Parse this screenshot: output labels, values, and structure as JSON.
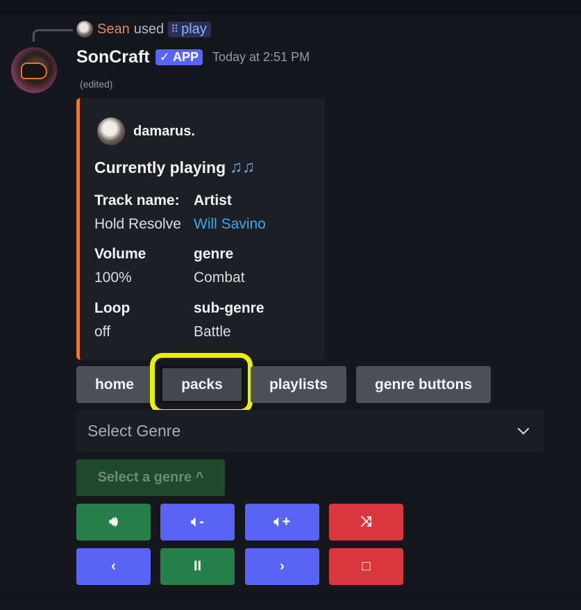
{
  "reply": {
    "name": "Sean",
    "used_text": "used",
    "command_icon": "slash-command-icon",
    "command": "play"
  },
  "message": {
    "author": "SonCraft",
    "badge": "✓ APP",
    "timestamp": "Today at 2:51 PM",
    "edited": "(edited)"
  },
  "embed": {
    "accent_color": "#e8793a",
    "author_name": "damarus.",
    "title": "Currently playing",
    "title_emoji": "♫♫",
    "fields": [
      {
        "name": "Track name:",
        "value": "Hold Resolve"
      },
      {
        "name": "Artist",
        "value": "Will Savino"
      },
      {
        "name": "Volume",
        "value": "100%"
      },
      {
        "name": "genre",
        "value": "Combat"
      },
      {
        "name": "Loop",
        "value": "off"
      },
      {
        "name": "sub-genre",
        "value": "Battle"
      }
    ]
  },
  "nav_buttons": {
    "home": "home",
    "packs": "packs",
    "playlists": "playlists",
    "genre_buttons": "genre buttons"
  },
  "select": {
    "placeholder": "Select Genre"
  },
  "disabled_button": {
    "label": "Select a genre ^"
  },
  "controls": {
    "row1": [
      {
        "icon": "speaker-icon",
        "glyph": "🔊︎",
        "color": "green"
      },
      {
        "icon": "volume-down-icon",
        "glyph": "🔈︎-",
        "color": "blue"
      },
      {
        "icon": "volume-up-icon",
        "glyph": "🔈︎+",
        "color": "blue"
      },
      {
        "icon": "shuffle-icon",
        "glyph": "⤨",
        "color": "red"
      }
    ],
    "row2": [
      {
        "icon": "previous-icon",
        "glyph": "‹",
        "color": "blue"
      },
      {
        "icon": "pause-icon",
        "glyph": "II",
        "color": "green"
      },
      {
        "icon": "next-icon",
        "glyph": "›",
        "color": "blue"
      },
      {
        "icon": "stop-icon",
        "glyph": "□",
        "color": "red"
      }
    ]
  },
  "colors": {
    "green": "#248046",
    "blue": "#5865f2",
    "red": "#da373c",
    "highlight": "#e9f000"
  }
}
